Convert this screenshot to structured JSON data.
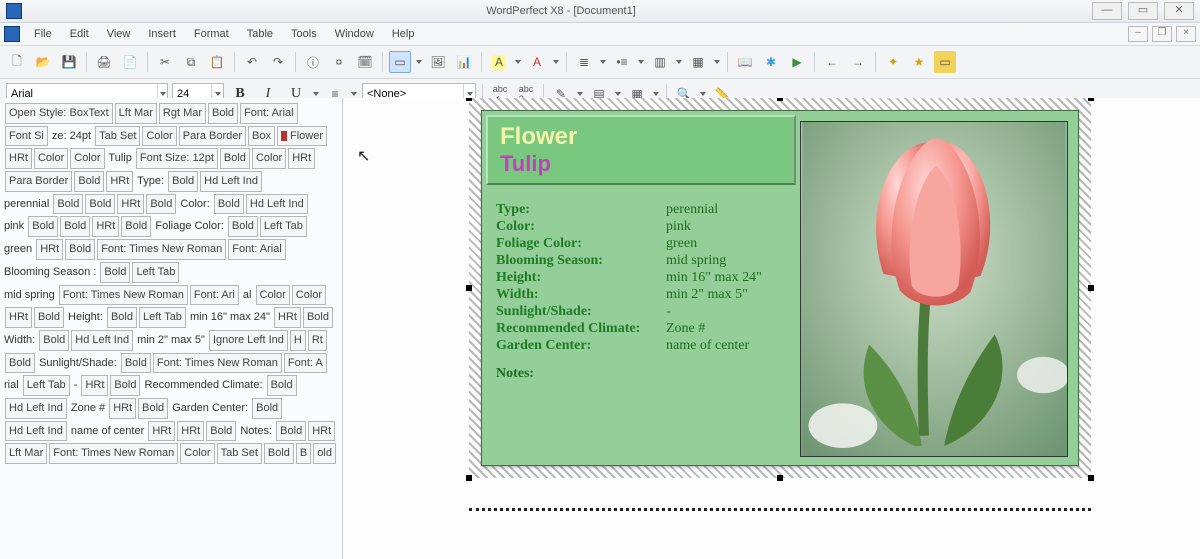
{
  "title": "WordPerfect X8 - [Document1]",
  "menus": {
    "file": "File",
    "edit": "Edit",
    "view": "View",
    "insert": "Insert",
    "format": "Format",
    "table": "Table",
    "tools": "Tools",
    "window": "Window",
    "help": "Help"
  },
  "propbar": {
    "font": "Arial",
    "size": "24",
    "style_combo": "<None>"
  },
  "reveal_codes": [
    "Open Style: BoxText",
    "Lft Mar",
    "Rgt Mar",
    "Bold",
    "Font: Arial",
    "Font Si",
    "ze: 24pt",
    "Tab Set",
    "Color",
    "Para Border",
    "Box",
    "Flower",
    "HRt",
    "Color",
    "Color",
    "Tulip",
    "Font Size: 12pt",
    "Bold",
    "Color",
    "HRt",
    "Para Border",
    "Bold",
    "HRt",
    "Type:",
    "Bold",
    "Hd Left Ind",
    "perennial",
    "Bold",
    "Bold",
    "HRt",
    "Bold",
    "Color:",
    "Bold",
    "Hd Left Ind",
    "pink",
    "Bold",
    "Bold",
    "HRt",
    "Bold",
    "Foliage Color:",
    "Bold",
    "Left Tab",
    "green",
    "HRt",
    "Bold",
    "Font: Times New Roman",
    "Font: Arial",
    "Blooming Season",
    ":",
    "Bold",
    "Left Tab",
    "mid spring",
    "Font: Times New Roman",
    "Font: Ari",
    "al",
    "Color",
    "Color",
    "HRt",
    "Bold",
    "Height:",
    "Bold",
    "Left Tab",
    "min 16\" max 24\"",
    "HRt",
    "Bold",
    "Width:",
    "Bold",
    "Hd Left Ind",
    "min 2\" max 5\"",
    "Ignore Left Ind",
    "H",
    "Rt",
    "Bold",
    "Sunlight/Shade:",
    "Bold",
    "Font: Times New Roman",
    "Font: A",
    "rial",
    "Left Tab",
    "-",
    "HRt",
    "Bold",
    "Recommended Climate:",
    "Bold",
    "Hd Left Ind",
    "Zone #",
    "HRt",
    "Bold",
    "Garden Center:",
    "Bold",
    "Hd Left Ind",
    "name of center",
    "HRt",
    "HRt",
    "Bold",
    "Notes:",
    "Bold",
    "HRt",
    "Lft Mar",
    "Font: Times New Roman",
    "Color",
    "Tab Set",
    "Bold",
    "B",
    "old"
  ],
  "doc": {
    "heading1": "Flower",
    "heading2": "Tulip",
    "rows": [
      {
        "label": "Type:",
        "value": "perennial"
      },
      {
        "label": "Color:",
        "value": "pink"
      },
      {
        "label": "Foliage Color:",
        "value": "green"
      },
      {
        "label": "Blooming Season:",
        "value": "mid spring"
      },
      {
        "label": "Height:",
        "value": "min 16\" max 24\""
      },
      {
        "label": "Width:",
        "value": "min 2\" max 5\""
      },
      {
        "label": "Sunlight/Shade:",
        "value": "-"
      },
      {
        "label": "Recommended Climate:",
        "value": "Zone #"
      },
      {
        "label": "Garden Center:",
        "value": "name of center"
      }
    ],
    "notes_label": "Notes:"
  }
}
